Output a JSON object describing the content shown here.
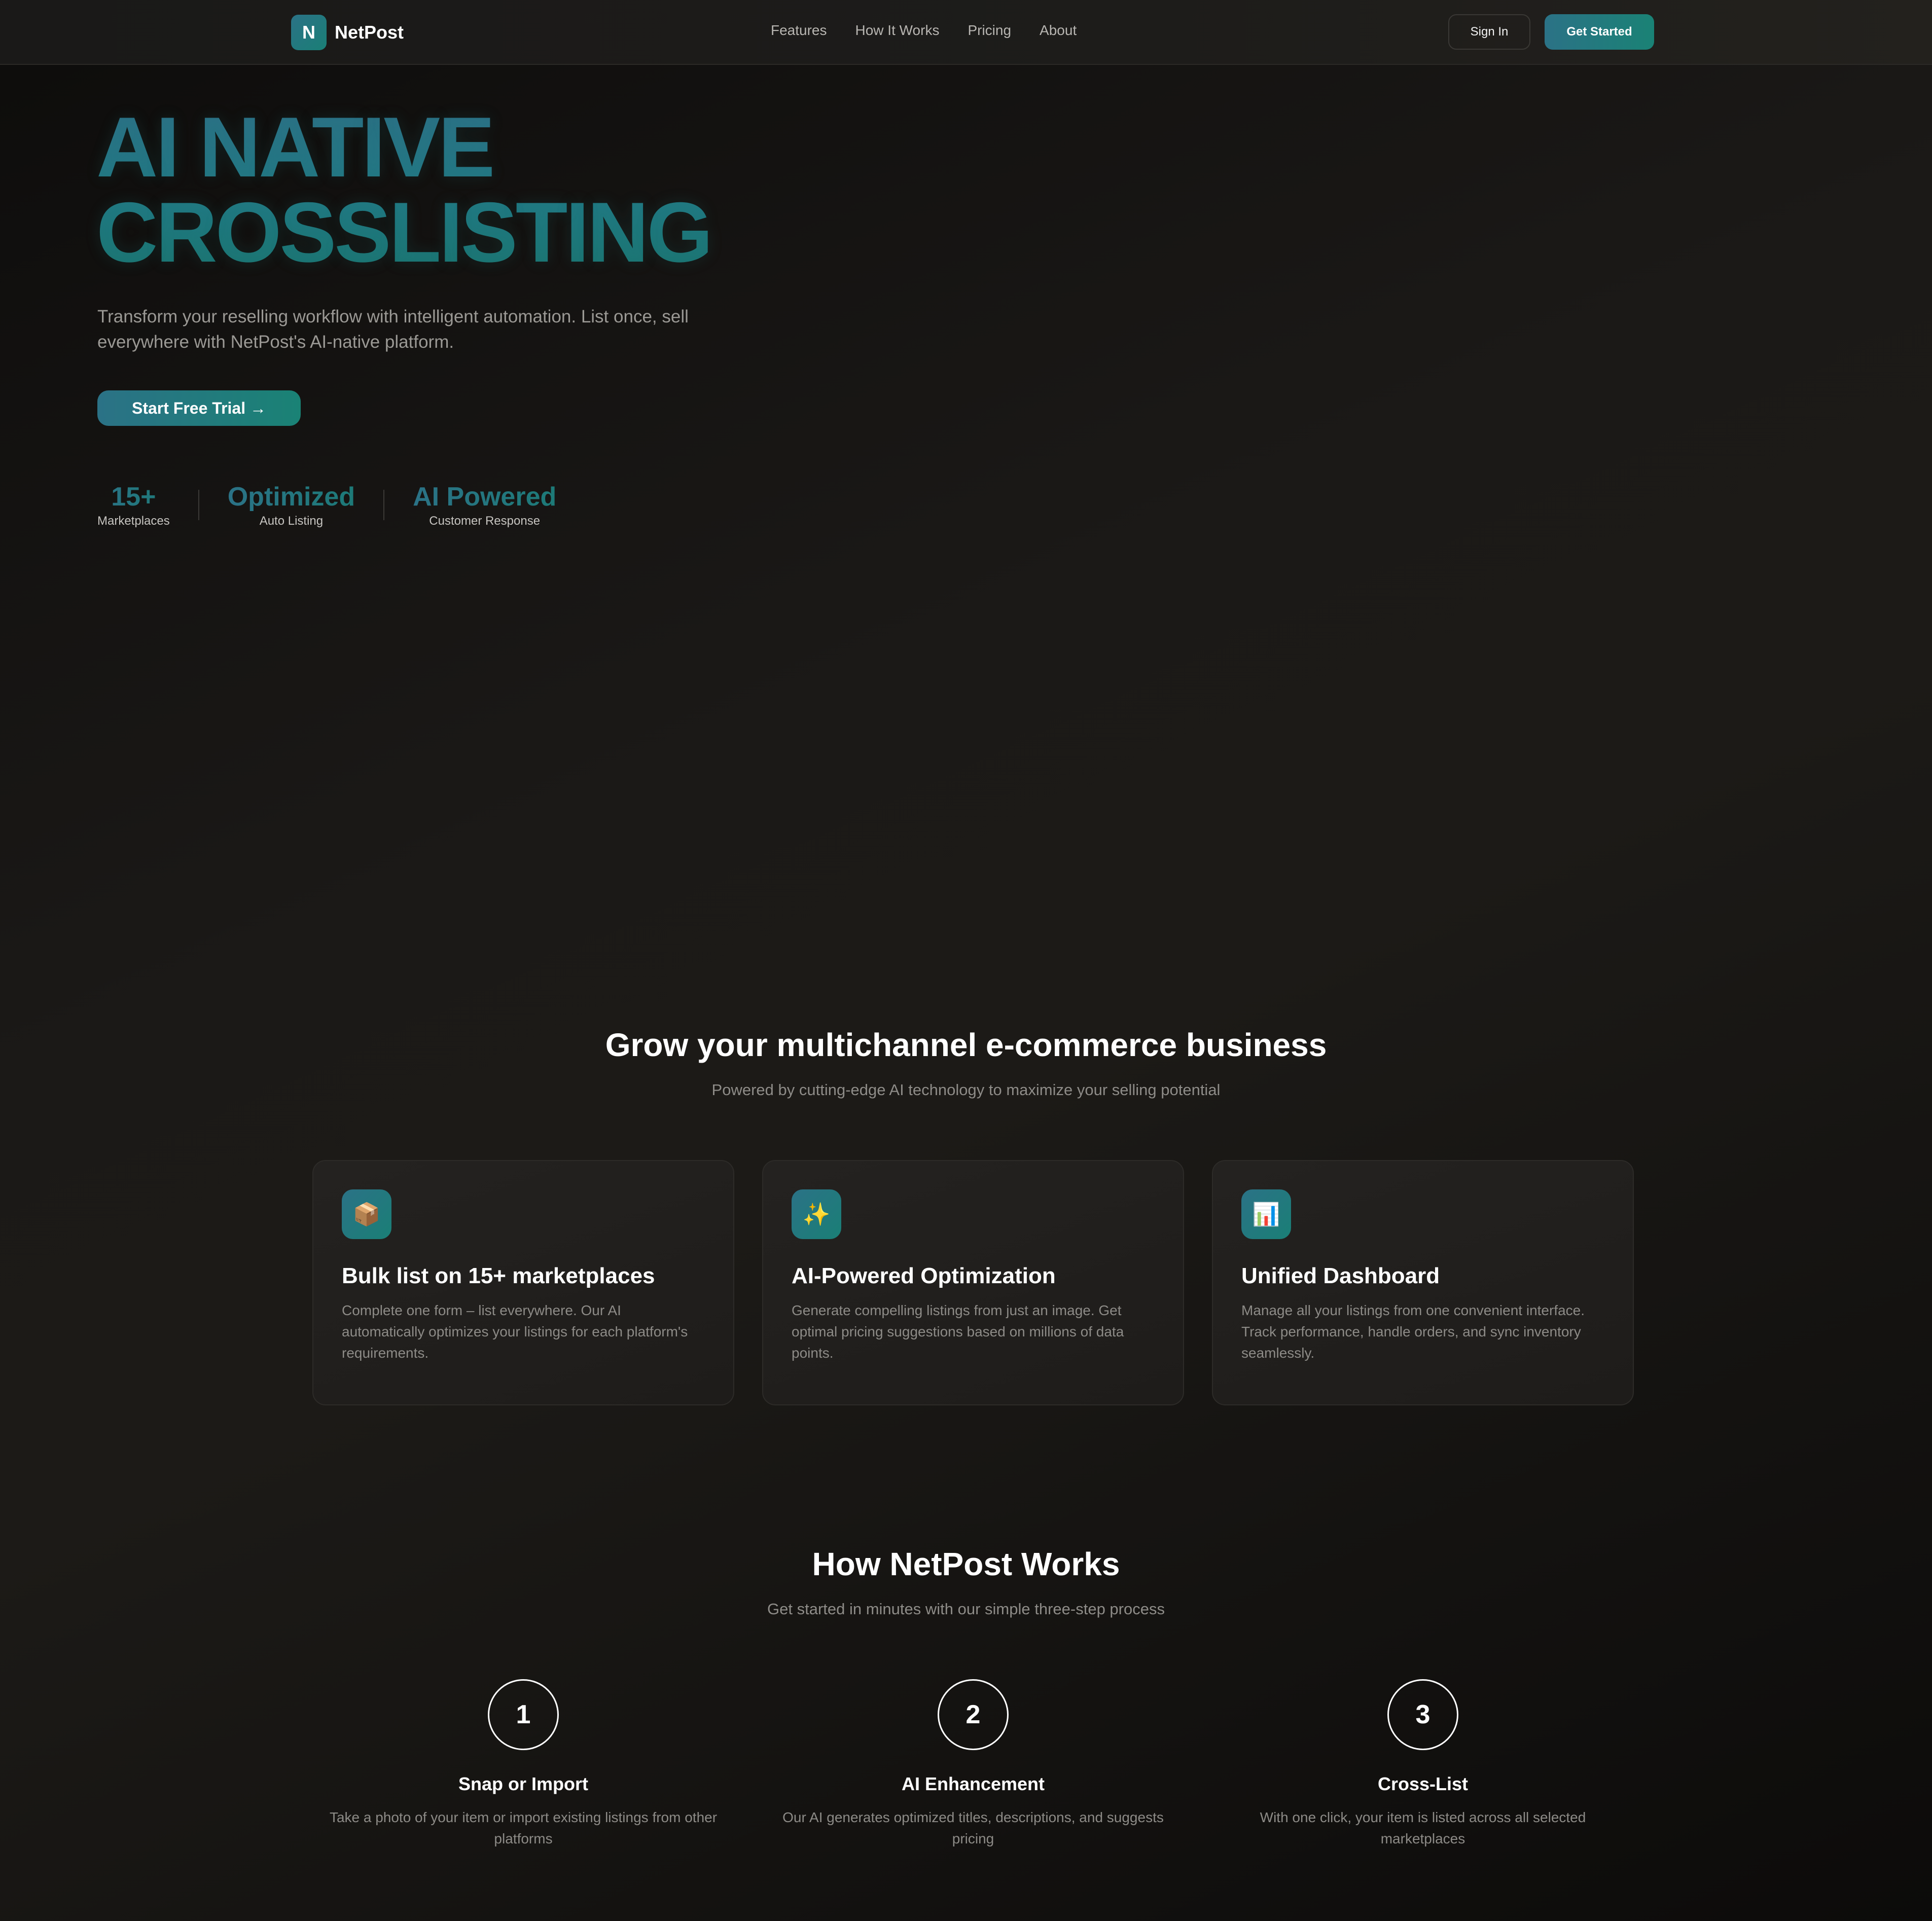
{
  "brand": {
    "logo_letter": "N",
    "name": "NetPost",
    "accent_start": "#2b7286",
    "accent_end": "#1a8275"
  },
  "nav": {
    "links": [
      "Features",
      "How It Works",
      "Pricing",
      "About"
    ],
    "sign_in": "Sign In",
    "get_started": "Get Started"
  },
  "hero": {
    "title_line1": "AI NATIVE",
    "title_line2": "CROSSLISTING",
    "subtitle": "Transform your reselling workflow with intelligent automation. List once, sell everywhere with NetPost's AI-native platform.",
    "cta": "Start Free Trial →",
    "stats": [
      {
        "value": "15+",
        "label": "Marketplaces"
      },
      {
        "value": "Optimized",
        "label": "Auto Listing"
      },
      {
        "value": "AI Powered",
        "label": "Customer Response"
      }
    ]
  },
  "features": {
    "title": "Grow your multichannel e-commerce business",
    "subtitle": "Powered by cutting-edge AI technology to maximize your selling potential",
    "cards": [
      {
        "icon": "package-icon",
        "glyph": "📦",
        "title": "Bulk list on 15+ marketplaces",
        "desc": "Complete one form – list everywhere. Our AI automatically optimizes your listings for each platform's requirements."
      },
      {
        "icon": "sparkles-icon",
        "glyph": "✨",
        "title": "AI-Powered Optimization",
        "desc": "Generate compelling listings from just an image. Get optimal pricing suggestions based on millions of data points."
      },
      {
        "icon": "bar-chart-icon",
        "glyph": "📊",
        "title": "Unified Dashboard",
        "desc": "Manage all your listings from one convenient interface. Track performance, handle orders, and sync inventory seamlessly."
      }
    ]
  },
  "how": {
    "title": "How NetPost Works",
    "subtitle": "Get started in minutes with our simple three-step process",
    "steps": [
      {
        "number": "1",
        "title": "Snap or Import",
        "desc": "Take a photo of your item or import existing listings from other platforms"
      },
      {
        "number": "2",
        "title": "AI Enhancement",
        "desc": "Our AI generates optimized titles, descriptions, and suggests pricing"
      },
      {
        "number": "3",
        "title": "Cross-List",
        "desc": "With one click, your item is listed across all selected marketplaces"
      }
    ]
  }
}
